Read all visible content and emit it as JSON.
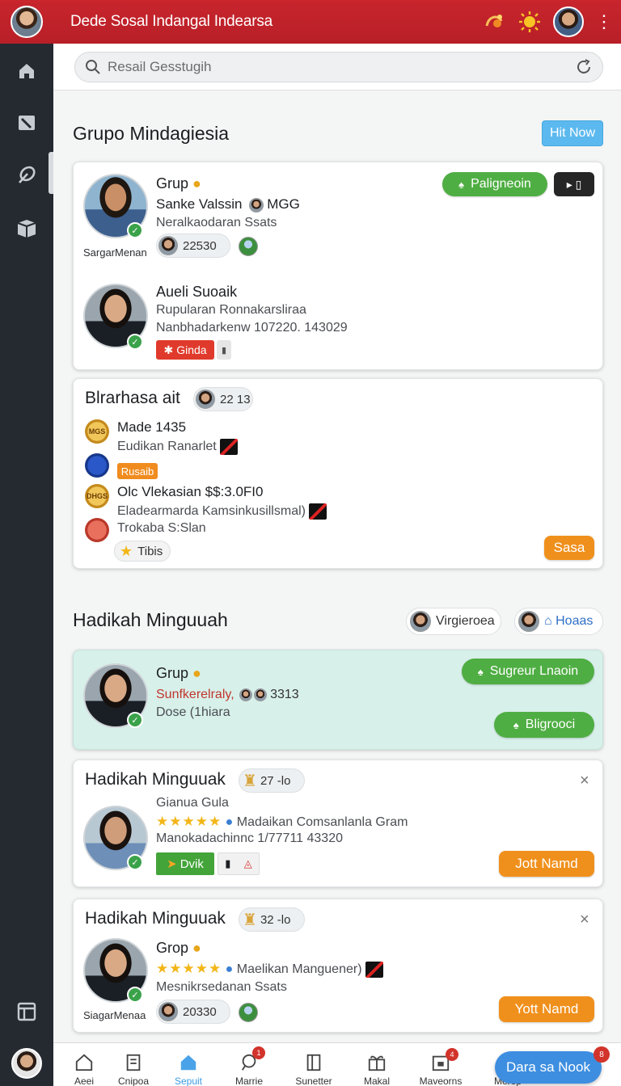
{
  "topbar": {
    "title": "Dede Sosal Indangal Indearsa",
    "icons": [
      "profile-avatar",
      "notification-icon",
      "sun-icon",
      "user-avatar",
      "more-icon"
    ]
  },
  "sidebar": {
    "items": [
      "home-icon",
      "tag-icon",
      "leaf-icon",
      "box-icon",
      "layout-icon",
      "user-avatar"
    ]
  },
  "search": {
    "placeholder": "Resail Gesstugih"
  },
  "section1": {
    "title": "Grupo Mindagiesia",
    "action": "Hit Now",
    "card1": {
      "entry1": {
        "title": "Grup",
        "line1": "Sanke Valssin",
        "line1b": "MGG",
        "line2": "Neralkaodaran Ssats",
        "avatar_caption": "SargarMenan",
        "pill_value": "22530",
        "primary_button": "Paligneoin",
        "dark_button": "▸ ▯"
      },
      "entry2": {
        "title": "Aueli Suoaik",
        "line1": "Rupularan Ronnakarsliraa",
        "line2": "Nanbhadarkenw 107220. 143029",
        "tag": "Ginda"
      }
    },
    "card2": {
      "title": "Blrarhasa ait",
      "title_pill": "22 13",
      "rows": [
        {
          "medal": "MGS",
          "medal_type": "gold",
          "name": "Made 1435",
          "detail": "Eudikan Ranarlet"
        },
        {
          "medal": "",
          "medal_type": "blue",
          "tag": "Rusaib"
        },
        {
          "medal": "DHGS",
          "medal_type": "gold",
          "name": "Olc Vlekasian $$:3.0FI0",
          "detail": "Eladearmarda Kamsinkusillsmal)"
        },
        {
          "medal": "",
          "medal_type": "red",
          "detail": "Trokaba S:Slan"
        }
      ],
      "star_pill": "Tibis",
      "button": "Sasa"
    }
  },
  "section2": {
    "title": "Hadikah Minguuah",
    "chips": [
      {
        "label": "Virgieroea"
      },
      {
        "label": "⌂ Hoaas"
      }
    ],
    "card_mint": {
      "title": "Grup",
      "line1": "Sunfkerelraly,",
      "line1b": "3313",
      "line2": "Dose (1hiara",
      "button1": "Sugreur Lnaoin",
      "button2": "Bligrooci"
    },
    "card_a": {
      "title": "Hadikah Minguuak",
      "title_pill": "27 -lo",
      "line1": "Gianua Gula",
      "line2": "Madaikan Comsanlanla Gram",
      "line3": "Manokadachinnc 1/77711 43320",
      "green_tag": "Dvik",
      "button": "Jott Namd",
      "close": "×"
    },
    "card_b": {
      "title": "Hadikah Minguuak",
      "title_pill": "32 -lo",
      "line0": "Grop",
      "line2": "Maelikan Manguener)",
      "line3": "Mesnikrsedanan Ssats",
      "avatar_caption": "SiagarMenaa",
      "pill_value": "20330",
      "button": "Yott Namd",
      "close": "×"
    }
  },
  "bottomnav": {
    "items": [
      {
        "label": "Aeei",
        "icon": "home-icon",
        "badge": ""
      },
      {
        "label": "Cnipoa",
        "icon": "document-icon",
        "badge": ""
      },
      {
        "label": "Sepuit",
        "icon": "home-filled-icon",
        "badge": ""
      },
      {
        "label": "Marrie",
        "icon": "search-icon",
        "badge": "1"
      },
      {
        "label": "Sunetter",
        "icon": "book-icon",
        "badge": ""
      },
      {
        "label": "Makal",
        "icon": "gift-icon",
        "badge": ""
      },
      {
        "label": "Maveorns",
        "icon": "calendar-icon",
        "badge": "4"
      },
      {
        "label": "Merop",
        "icon": "grid-icon",
        "badge": "8"
      }
    ],
    "fab": "Dara sa Nook"
  }
}
